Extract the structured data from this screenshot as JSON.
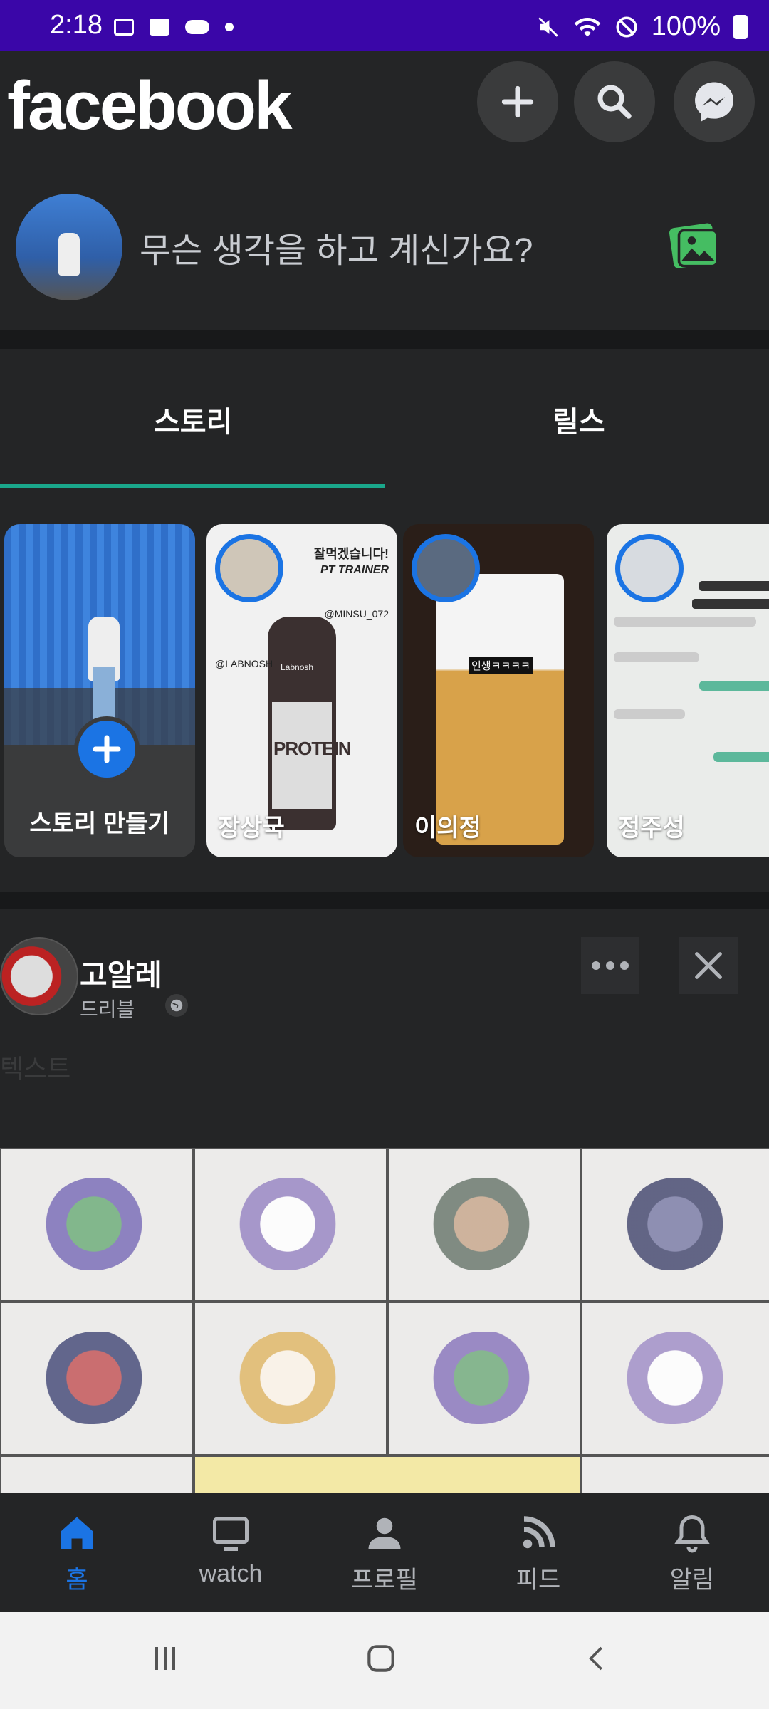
{
  "status_bar": {
    "time": "2:18",
    "battery": "100%"
  },
  "header": {
    "logo": "facebook",
    "icons": [
      "plus-icon",
      "search-icon",
      "messenger-icon"
    ]
  },
  "composer": {
    "placeholder": "무슨 생각을 하고 계신가요?",
    "icon": "photo-icon"
  },
  "tabs": {
    "stories_label": "스토리",
    "reels_label": "릴스",
    "active": "스토리",
    "accent": "#1aa78b"
  },
  "stories": [
    {
      "label": "스토리 만들기",
      "type": "create"
    },
    {
      "label": "장상국",
      "overlay": [
        "잘먹겠습니다!",
        "PT TRAINER",
        "@MINSU_072",
        "@LABNOSH_",
        "PROTEIN",
        "Labnosh"
      ]
    },
    {
      "label": "이의정",
      "overlay": [
        "인생ㅋㅋㅋㅋ"
      ]
    },
    {
      "label": "정주성"
    }
  ],
  "post": {
    "author": "고알레",
    "subtitle": "드리블",
    "body_text": "텍스트",
    "image_grid_rows": 3,
    "image_grid_cols": 4
  },
  "bottom_nav": [
    {
      "label": "홈",
      "icon": "home-icon",
      "active": true
    },
    {
      "label": "watch",
      "icon": "tv-icon",
      "active": false
    },
    {
      "label": "프로필",
      "icon": "person-icon",
      "active": false
    },
    {
      "label": "피드",
      "icon": "feed-icon",
      "active": false
    },
    {
      "label": "알림",
      "icon": "bell-icon",
      "active": false
    }
  ],
  "colors": {
    "brand": "#1b74e4",
    "status_bar": "#3a06a8",
    "background": "#242526"
  }
}
